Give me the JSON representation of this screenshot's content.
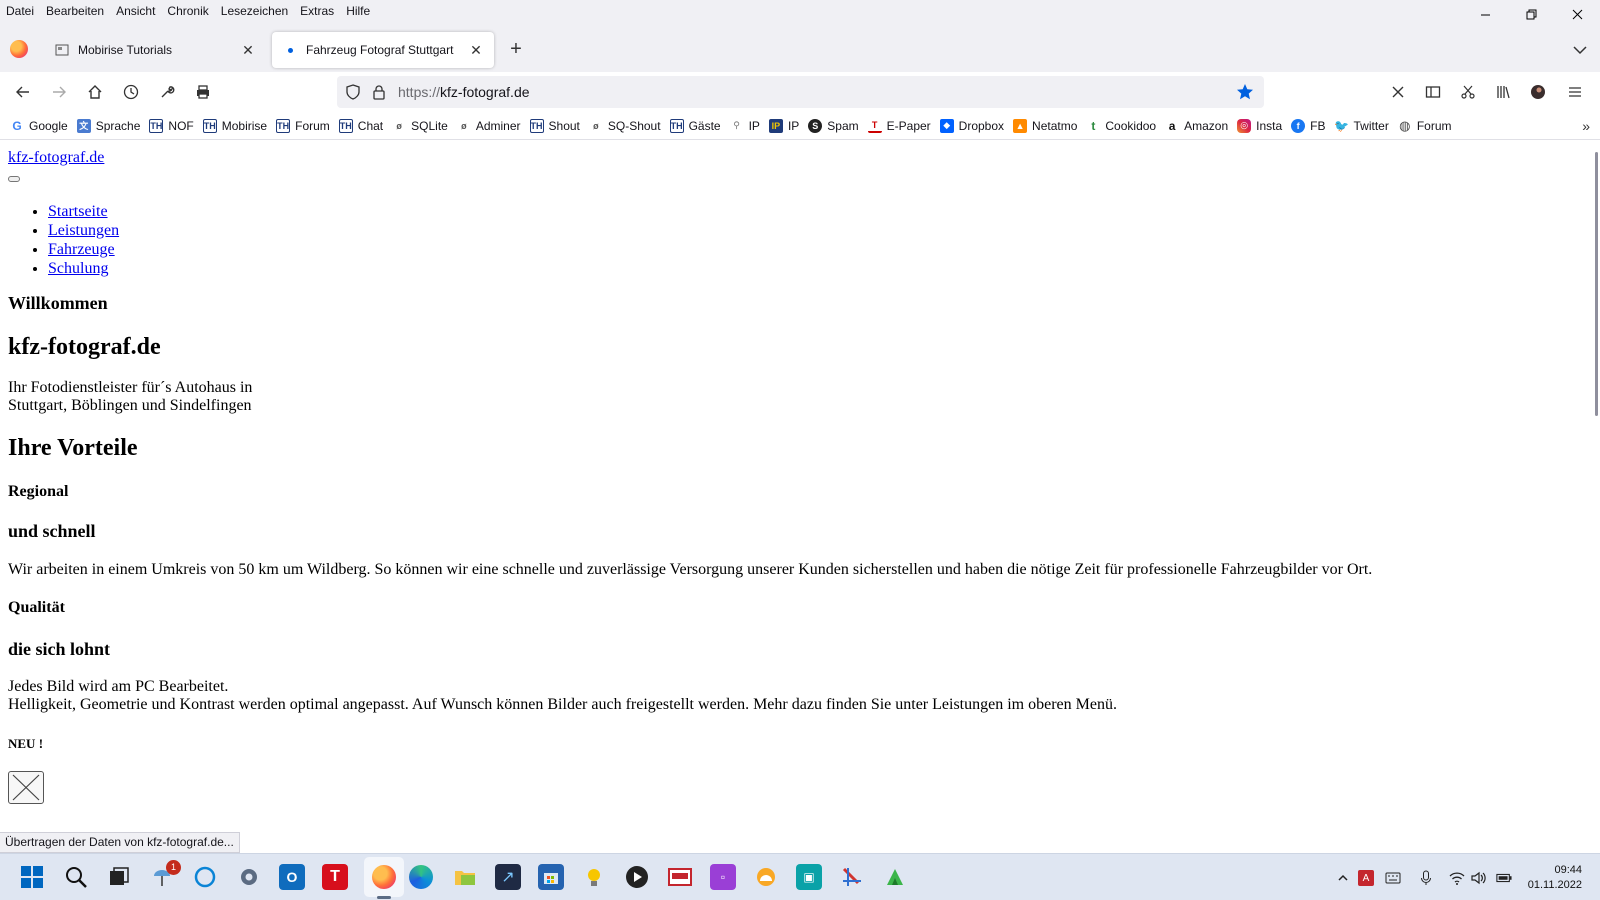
{
  "menu": [
    "Datei",
    "Bearbeiten",
    "Ansicht",
    "Chronik",
    "Lesezeichen",
    "Extras",
    "Hilfe"
  ],
  "tabs": [
    {
      "title": "Mobirise Tutorials",
      "icon": "tutorial-page-icon"
    },
    {
      "title": "Fahrzeug Fotograf Stuttgart",
      "icon": "loading-dot-icon",
      "active": true
    }
  ],
  "url": {
    "protocol": "https://",
    "host": "kfz-fotograf.de"
  },
  "bookmarks": [
    {
      "label": "Google",
      "icon": "google-icon"
    },
    {
      "label": "Sprache",
      "icon": "translate-icon"
    },
    {
      "label": "NOF",
      "icon": "th-icon"
    },
    {
      "label": "Mobirise",
      "icon": "th-icon"
    },
    {
      "label": "Forum",
      "icon": "th-icon"
    },
    {
      "label": "Chat",
      "icon": "th-icon"
    },
    {
      "label": "SQLite",
      "icon": "db-icon"
    },
    {
      "label": "Adminer",
      "icon": "db-icon"
    },
    {
      "label": "Shout",
      "icon": "th-icon"
    },
    {
      "label": "SQ-Shout",
      "icon": "db-icon"
    },
    {
      "label": "Gäste",
      "icon": "th-icon"
    },
    {
      "label": "IP",
      "icon": "pin-icon"
    },
    {
      "label": "IP",
      "icon": "ip-icon"
    },
    {
      "label": "Spam",
      "icon": "spam-icon"
    },
    {
      "label": "E-Paper",
      "icon": "epaper-icon"
    },
    {
      "label": "Dropbox",
      "icon": "dropbox-icon"
    },
    {
      "label": "Netatmo",
      "icon": "netatmo-icon"
    },
    {
      "label": "Cookidoo",
      "icon": "cookidoo-icon"
    },
    {
      "label": "Amazon",
      "icon": "amazon-icon"
    },
    {
      "label": "Insta",
      "icon": "instagram-icon"
    },
    {
      "label": "FB",
      "icon": "facebook-icon"
    },
    {
      "label": "Twitter",
      "icon": "twitter-icon"
    },
    {
      "label": "Forum",
      "icon": "globe-icon"
    }
  ],
  "page": {
    "site_link": "kfz-fotograf.de",
    "nav": [
      "Startseite",
      "Leistungen",
      "Fahrzeuge",
      "Schulung"
    ],
    "welcome": "Willkommen",
    "title": "kfz-fotograf.de",
    "intro_line1": "Ihr Fotodienstleister für´s Autohaus in",
    "intro_line2": "Stuttgart, Böblingen und Sindelfingen",
    "advantages": "Ihre Vorteile",
    "regional": "Regional",
    "fast": "und schnell",
    "regional_text": "Wir arbeiten in einem Umkreis von 50 km um Wildberg. So können wir eine schnelle und zuverlässige Versorgung unserer Kunden sicherstellen und haben die nötige Zeit für professionelle Fahrzeugbilder vor Ort.",
    "quality": "Qualität",
    "worth": "die sich lohnt",
    "quality_line1": "Jedes Bild wird am PC Bearbeitet.",
    "quality_line2": "Helligkeit, Geometrie und Kontrast werden optimal angepasst. Auf Wunsch können Bilder auch freigestellt werden. Mehr dazu finden Sie unter Leistungen im oberen Menü.",
    "new": "NEU !"
  },
  "status": "Übertragen der Daten von kfz-fotograf.de...",
  "taskbar": {
    "badge_count": "1",
    "time": "09:44",
    "date": "01.11.2022"
  },
  "colors": {
    "accent": "#0060df",
    "link": "#0000ee",
    "taskbar": "#dfe6f2"
  }
}
